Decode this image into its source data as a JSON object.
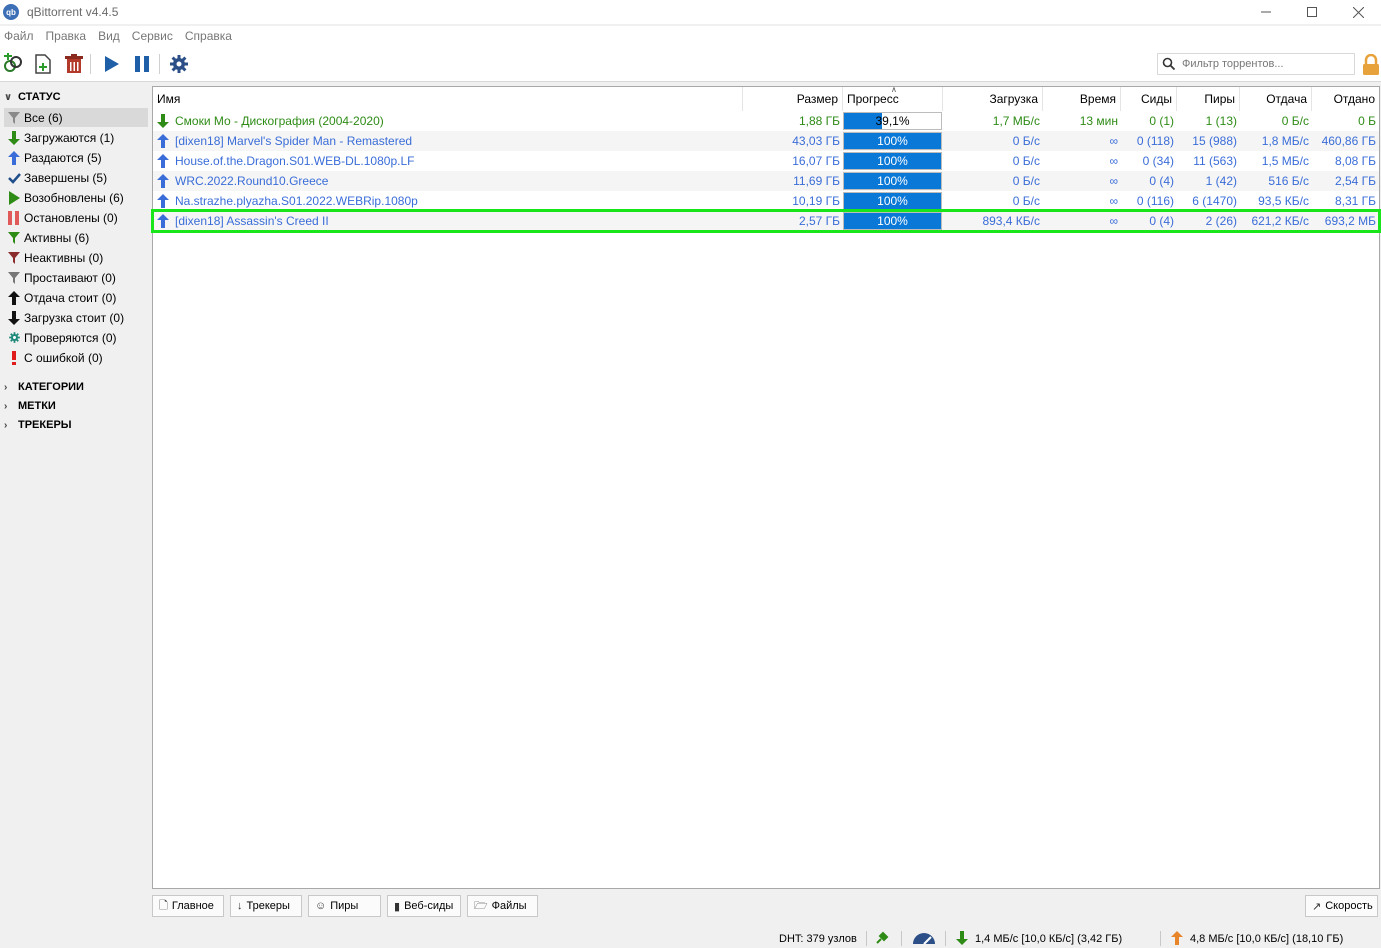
{
  "window": {
    "title": "qBittorrent v4.4.5",
    "icon_text": "qb"
  },
  "menu": [
    "Файл",
    "Правка",
    "Вид",
    "Сервис",
    "Справка"
  ],
  "toolbar": {
    "filter_placeholder": "Фильтр торрентов..."
  },
  "sidebar": {
    "status_header": "СТАТУС",
    "status_items": [
      {
        "label": "Все (6)",
        "icon": "filter-icon"
      },
      {
        "label": "Загружаются (1)",
        "icon": "arrow-down-icon"
      },
      {
        "label": "Раздаются (5)",
        "icon": "arrow-up-icon"
      },
      {
        "label": "Завершены (5)",
        "icon": "check-icon"
      },
      {
        "label": "Возобновлены (6)",
        "icon": "play-icon"
      },
      {
        "label": "Остановлены (0)",
        "icon": "pause-icon"
      },
      {
        "label": "Активны (6)",
        "icon": "filter-icon"
      },
      {
        "label": "Неактивны (0)",
        "icon": "filter-icon"
      },
      {
        "label": "Простаивают (0)",
        "icon": "filter-icon"
      },
      {
        "label": "Отдача стоит (0)",
        "icon": "arrow-up-icon"
      },
      {
        "label": "Загрузка стоит (0)",
        "icon": "arrow-down-icon"
      },
      {
        "label": "Проверяются (0)",
        "icon": "gear-icon"
      },
      {
        "label": "С ошибкой (0)",
        "icon": "error-icon"
      }
    ],
    "categories_header": "КАТЕГОРИИ",
    "tags_header": "МЕТКИ",
    "trackers_header": "ТРЕКЕРЫ"
  },
  "table": {
    "columns": {
      "name": "Имя",
      "size": "Размер",
      "progress": "Прогресс",
      "download": "Загрузка",
      "eta": "Время",
      "seeds": "Сиды",
      "peers": "Пиры",
      "upload": "Отдача",
      "uploaded": "Отдано"
    },
    "rows": [
      {
        "name": "Смоки Мо - Дискография (2004-2020)",
        "size": "1,88 ГБ",
        "progress": 0.391,
        "progress_text": "39,1%",
        "download": "1,7 МБ/с",
        "eta": "13 мин",
        "seeds": "0 (1)",
        "peers": "1 (13)",
        "upload": "0 Б/с",
        "uploaded": "0 Б",
        "state": "downloading"
      },
      {
        "name": "[dixen18] Marvel's Spider Man - Remastered",
        "size": "43,03 ГБ",
        "progress": 1.0,
        "progress_text": "100%",
        "download": "0 Б/с",
        "eta": "∞",
        "seeds": "0 (118)",
        "peers": "15 (988)",
        "upload": "1,8 МБ/с",
        "uploaded": "460,86 ГБ",
        "state": "seeding"
      },
      {
        "name": "House.of.the.Dragon.S01.WEB-DL.1080p.LF",
        "size": "16,07 ГБ",
        "progress": 1.0,
        "progress_text": "100%",
        "download": "0 Б/с",
        "eta": "∞",
        "seeds": "0 (34)",
        "peers": "11 (563)",
        "upload": "1,5 МБ/с",
        "uploaded": "8,08 ГБ",
        "state": "seeding"
      },
      {
        "name": "WRC.2022.Round10.Greece",
        "size": "11,69 ГБ",
        "progress": 1.0,
        "progress_text": "100%",
        "download": "0 Б/с",
        "eta": "∞",
        "seeds": "0 (4)",
        "peers": "1 (42)",
        "upload": "516 Б/с",
        "uploaded": "2,54 ГБ",
        "state": "seeding"
      },
      {
        "name": "Na.strazhe.plyazha.S01.2022.WEBRip.1080p",
        "size": "10,19 ГБ",
        "progress": 1.0,
        "progress_text": "100%",
        "download": "0 Б/с",
        "eta": "∞",
        "seeds": "0 (116)",
        "peers": "6 (1470)",
        "upload": "93,5 КБ/с",
        "uploaded": "8,31 ГБ",
        "state": "seeding"
      },
      {
        "name": "[dixen18] Assassin's Creed II",
        "size": "2,57 ГБ",
        "progress": 1.0,
        "progress_text": "100%",
        "download": "893,4 КБ/с",
        "eta": "∞",
        "seeds": "0 (4)",
        "peers": "2 (26)",
        "upload": "621,2 КБ/с",
        "uploaded": "693,2 МБ",
        "state": "seeding"
      }
    ]
  },
  "tabs": {
    "general": "Главное",
    "trackers": "Трекеры",
    "peers": "Пиры",
    "webseeds": "Веб-сиды",
    "files": "Файлы",
    "speed": "Скорость"
  },
  "status": {
    "dht": "DHT: 379 узлов",
    "download": "1,4 МБ/с [10,0 КБ/с] (3,42 ГБ)",
    "upload": "4,8 МБ/с [10,0 КБ/с] (18,10 ГБ)"
  },
  "colors": {
    "downloading_text": "#2e8b16",
    "seeding_text": "#3a6dd8",
    "progress_fill": "#0a78d7",
    "selection_outline": "#18e51a"
  }
}
